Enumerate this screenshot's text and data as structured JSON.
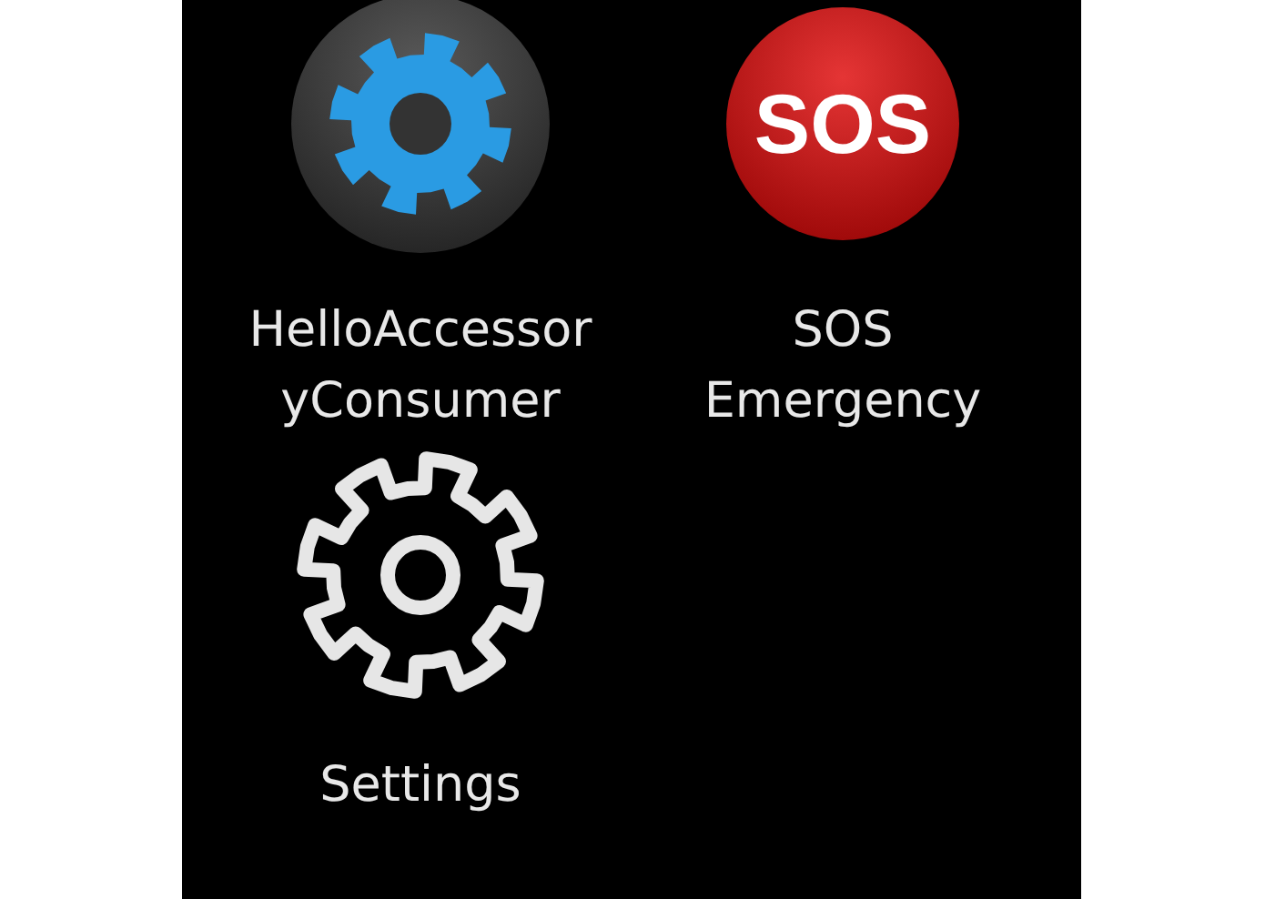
{
  "apps": [
    {
      "kind": "gear-badge",
      "label": "HelloAccessor\nyConsumer"
    },
    {
      "kind": "sos-badge",
      "badge_text": "SOS",
      "label": "SOS\nEmergency"
    },
    {
      "kind": "gear-outline",
      "label": "Settings"
    }
  ]
}
